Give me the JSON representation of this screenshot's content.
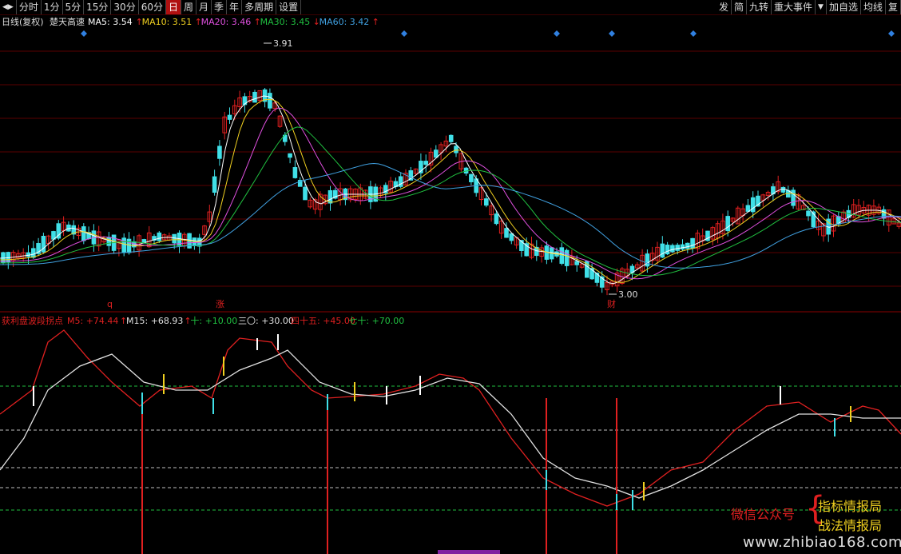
{
  "toolbar": {
    "left": [
      "分时",
      "1分",
      "5分",
      "15分",
      "30分",
      "60分",
      "日",
      "周",
      "月",
      "季",
      "年",
      "多周期",
      "设置"
    ],
    "active_index": 6,
    "right": [
      "发",
      "简",
      "九转",
      "重大事件",
      "加自选",
      "均线",
      "复"
    ]
  },
  "main_legend": {
    "title": "日线(复权)",
    "indicator": "楚天高速",
    "ma": [
      {
        "label": "MA5: 3.54",
        "arrow": "↑",
        "color": "#ffffff"
      },
      {
        "label": "MA10: 3.51",
        "arrow": "↑",
        "color": "#f0d020"
      },
      {
        "label": "MA20: 3.46",
        "arrow": "↑",
        "color": "#e050e0"
      },
      {
        "label": "MA30: 3.45",
        "arrow": "↓",
        "color": "#20c040"
      },
      {
        "label": "MA60: 3.42",
        "arrow": "↑",
        "color": "#40a0e0"
      }
    ]
  },
  "price_annotations": {
    "high": "3.91",
    "low": "3.00"
  },
  "event_markers": [
    "q",
    "涨",
    "财"
  ],
  "sub_legend": {
    "name": "获利盘波段拐点",
    "items": [
      {
        "label": "M5: +74.44",
        "arrow": "↑",
        "color": "#e02020"
      },
      {
        "label": "M15: +68.93",
        "arrow": "↑",
        "color": "#e0e0e0"
      },
      {
        "label": "十: +10.00",
        "arrow": "",
        "color": "#20c040"
      },
      {
        "label": "三〇: +30.00",
        "arrow": "",
        "color": "#e0e0e0"
      },
      {
        "label": "四十五: +45.00",
        "arrow": "",
        "color": "#e02020"
      },
      {
        "label": "七十: +70.00",
        "arrow": "",
        "color": "#20c040"
      }
    ]
  },
  "watermark": {
    "wechat": "微信公众号",
    "line1": "指标情报局",
    "line2": "战法情报局",
    "url": "www.zhibiao168.com"
  },
  "colors": {
    "up": "#e02020",
    "down": "#40e0e8",
    "ma5": "#ffffff",
    "ma10": "#f0d020",
    "ma20": "#e050e0",
    "ma30": "#20c040",
    "ma60": "#40a0e0",
    "grid": "#5a0000",
    "dash_green": "#20c040",
    "dash_white": "#c0c0c0",
    "m5": "#e02020",
    "m15": "#e0e0e0"
  }
}
